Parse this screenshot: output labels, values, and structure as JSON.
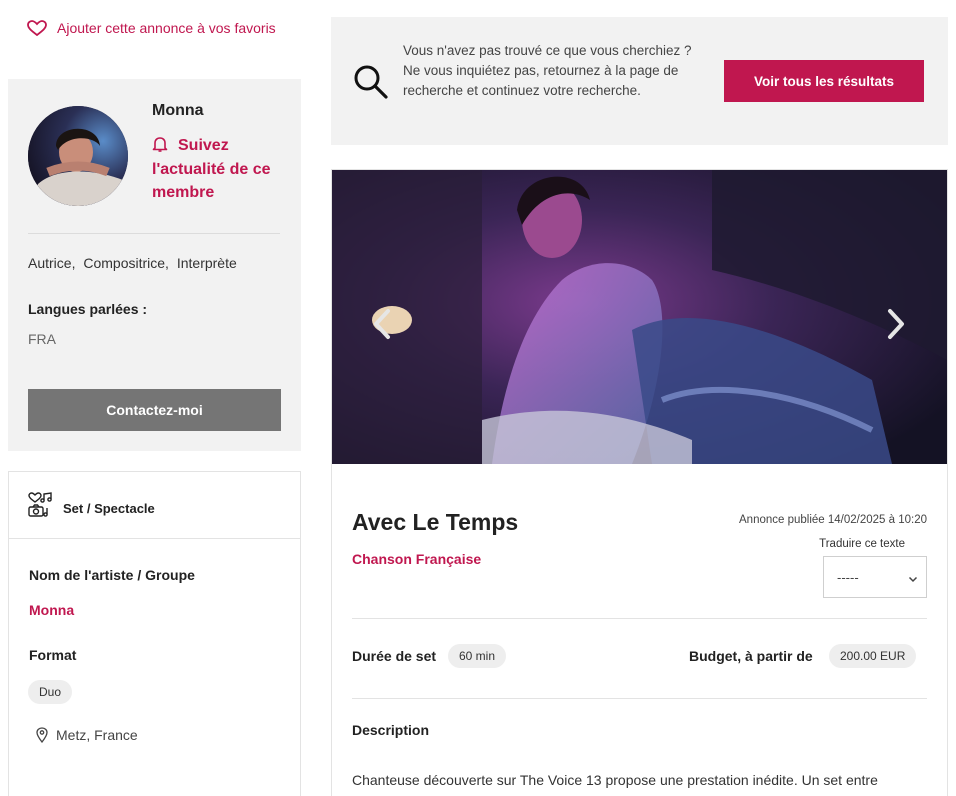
{
  "favorites": {
    "label": "Ajouter cette annonce à vos favoris"
  },
  "profile": {
    "name": "Monna",
    "follow_label": "Suivez l'actualité de ce membre",
    "roles": [
      "Autrice,",
      "Compositrice,",
      "Interprète"
    ],
    "languages_label": "Langues parlées :",
    "languages_value": "FRA",
    "contact_label": "Contactez-moi"
  },
  "set": {
    "header_label": "Set / Spectacle",
    "artist_label": "Nom de l'artiste / Groupe",
    "artist_value": "Monna",
    "format_label": "Format",
    "format_value": "Duo",
    "location": "Metz, France"
  },
  "search_banner": {
    "text": "Vous n'avez pas trouvé ce que vous cherchiez ? Ne vous inquiétez pas, retournez à la page de recherche et continuez votre recherche.",
    "button_label": "Voir tous les résultats"
  },
  "listing": {
    "title": "Avec Le Temps",
    "genre": "Chanson Française",
    "published": "Annonce publiée 14/02/2025 à 10:20",
    "translate_label": "Traduire ce texte",
    "translate_value": "-----",
    "duration_label": "Durée de set",
    "duration_value": "60 min",
    "budget_label": "Budget, à partir de",
    "budget_value": "200.00 EUR",
    "description_label": "Description",
    "description_text": "Chanteuse découverte sur The Voice 13 propose une prestation inédite. Un set entre"
  },
  "colors": {
    "accent": "#c0174f",
    "panel": "#f2f2f2",
    "contact_button": "#757575"
  },
  "icons": {
    "favorite": "heart-icon",
    "follow": "bell-icon",
    "set": "music-camera-icon",
    "location": "map-pin-icon",
    "search": "magnifier-icon",
    "slider_prev": "chevron-left-icon",
    "slider_next": "chevron-right-icon",
    "select": "chevron-down-icon"
  }
}
